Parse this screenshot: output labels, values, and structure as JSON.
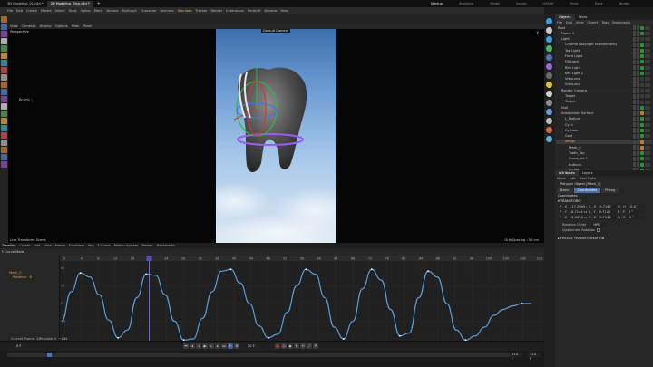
{
  "titlebar": {
    "tabs": [
      "3D Modeling_01.c4d *",
      "3D Modeling_Trick.c4d *"
    ],
    "plus": "+",
    "workspaces": [
      "Startup",
      "Standard",
      "Model",
      "Sculpt",
      "UVEdit",
      "Paint",
      "Track",
      "Nodes"
    ],
    "active_workspace": "Startup"
  },
  "menubar": {
    "items": [
      "File",
      "Edit",
      "Create",
      "Modes",
      "Select",
      "Tools",
      "Spline",
      "Mesh",
      "Volume",
      "MoGraph",
      "Character",
      "Animate",
      "Simulate",
      "Tracker",
      "Render",
      "Extensions",
      "Redshift",
      "Window",
      "Help"
    ]
  },
  "viewport": {
    "menu": [
      "View",
      "Cameras",
      "Display",
      "Options",
      "Filter",
      "Panel"
    ],
    "label": "Perspective",
    "camera_tag": "Default Camera",
    "transform_state": "Live Transform: Scene",
    "grid_spacing": "Grid Spacing : 50 cm",
    "gizmo_axis": "Y",
    "colors": {
      "bg": "#050505",
      "sky": "#4a7cb6"
    }
  },
  "objects_panel": {
    "tabs": [
      "Objects",
      "Takes"
    ],
    "menu": [
      "File",
      "Edit",
      "View",
      "Object",
      "Tags",
      "Bookmarks"
    ],
    "rows": [
      {
        "name": "Root",
        "indent": 0,
        "tag": "green"
      },
      {
        "name": "Dome 1",
        "indent": 1,
        "tag": "green"
      },
      {
        "name": "Light",
        "indent": 1,
        "tag": "none"
      },
      {
        "name": "Chrome (Daylight Environment)",
        "indent": 2,
        "tag": "green"
      },
      {
        "name": "Top Light",
        "indent": 2,
        "tag": "green"
      },
      {
        "name": "Front Light",
        "indent": 2,
        "tag": "green"
      },
      {
        "name": "Fill Light",
        "indent": 2,
        "tag": "green"
      },
      {
        "name": "Rim Light",
        "indent": 2,
        "tag": "green"
      },
      {
        "name": "Key Light 1",
        "indent": 2,
        "tag": "green"
      },
      {
        "name": "Vrbounce",
        "indent": 2,
        "tag": "none"
      },
      {
        "name": "Vrbounce",
        "indent": 2,
        "tag": "none"
      },
      {
        "name": "Render Camera",
        "indent": 1,
        "tag": "none"
      },
      {
        "name": "Target",
        "indent": 2,
        "tag": "none"
      },
      {
        "name": "Target",
        "indent": 2,
        "tag": "none"
      },
      {
        "name": "Null",
        "indent": 1,
        "tag": "green"
      },
      {
        "name": "Subdivision Surface",
        "indent": 1,
        "tag": "orange"
      },
      {
        "name": "L_Molture",
        "indent": 2,
        "tag": "green"
      },
      {
        "name": "Cyl.1",
        "indent": 2,
        "tag": "green"
      },
      {
        "name": "Cylinder",
        "indent": 2,
        "tag": "green"
      },
      {
        "name": "Gold",
        "indent": 2,
        "tag": "green"
      },
      {
        "name": "Wings",
        "indent": 2,
        "tag": "orange",
        "selected": true
      },
      {
        "name": "Mesh_0",
        "indent": 3,
        "tag": "orange"
      },
      {
        "name": "Tooth_Top",
        "indent": 3,
        "tag": "green"
      },
      {
        "name": "Crane_loc.1",
        "indent": 3,
        "tag": "green"
      },
      {
        "name": "Buttons",
        "indent": 3,
        "tag": "green"
      },
      {
        "name": "Sculpt",
        "indent": 3,
        "tag": "green"
      },
      {
        "name": "Tooth_Y",
        "indent": 3,
        "tag": "green"
      }
    ]
  },
  "attributes_panel": {
    "tabs": [
      "Attributes",
      "Layers"
    ],
    "menu": [
      "Mode",
      "Edit",
      "User Data"
    ],
    "object_label": "Polygon Object [Mesh_0]",
    "subtabs": [
      "Basic",
      "Coordinates",
      "Phong"
    ],
    "active_subtab": "Coordinates",
    "section": "Coordinates",
    "group": "TRANSFORM",
    "rows": [
      {
        "p": "P . X",
        "pv": "-17.2005 cm",
        "s": "S . X",
        "sv": "0.7142",
        "r": "R . H",
        "rv": "-0.0 °"
      },
      {
        "p": "P . Y",
        "pv": "-8.7144 cm",
        "s": "S . Y",
        "sv": "0.7142",
        "r": "R . P",
        "rv": "0 °"
      },
      {
        "p": "P . Z",
        "pv": "-2.0896 cm",
        "s": "S . Z",
        "sv": "0.7142",
        "r": "R . B",
        "rv": "0 °"
      }
    ],
    "rotation_order_label": "Rotation Order",
    "rotation_order_value": "HPB",
    "quaternion_label": "Quaternion Rotation",
    "freeze_label": "FREEZE TRANSFORMATION"
  },
  "timeline": {
    "tabs": [
      "Timeline"
    ],
    "menu": [
      "Create",
      "Edit",
      "View",
      "Frame",
      "Functions",
      "Key",
      "F-Curve",
      "Motion System",
      "Marker",
      "Bookmarks"
    ],
    "mode_label": "F-Curve Mode",
    "tracks": [
      {
        "name": "Mesh_0",
        "color": "#e0a040"
      },
      {
        "name": "Rotation . B",
        "color": "#e0a040"
      }
    ],
    "ruler": [
      "0",
      "4",
      "8",
      "12",
      "16",
      "20",
      "24",
      "28",
      "32",
      "36",
      "40",
      "44",
      "48",
      "52",
      "56",
      "60",
      "64",
      "68",
      "72",
      "76",
      "80",
      "84",
      "88",
      "92",
      "96",
      "100",
      "104",
      "108",
      "112"
    ],
    "y_labels": [
      "60",
      "30",
      "0",
      "-30",
      "-60"
    ],
    "current_frame_label": "Current Frame: 20",
    "preview_label": "Preview: 0 → 114",
    "playhead_frame": "20",
    "curve_color": "#5b9bd8",
    "curve_samples": [
      -30,
      20,
      52,
      45,
      15,
      -28,
      -58,
      -45,
      10,
      50,
      48,
      15,
      -30,
      -62,
      -60,
      -25,
      20,
      55,
      58,
      35,
      0,
      -38,
      -58,
      -52,
      -15,
      30,
      58,
      50,
      10,
      -40,
      -60,
      -30,
      25,
      58,
      40,
      -10,
      -55,
      -50,
      10,
      55,
      45,
      0,
      -45,
      -62,
      -55,
      -40,
      -20,
      -10,
      -4,
      0,
      0
    ]
  },
  "playback": {
    "start": "0 F",
    "end_field": "114 F",
    "end2_field": "114 F",
    "frame_field": "20 F",
    "buttons": [
      "first-frame",
      "prev-key",
      "prev-frame",
      "play",
      "next-frame",
      "next-key",
      "last-frame"
    ]
  },
  "left_tools": [
    "move",
    "scale",
    "rotate",
    "select",
    "live",
    "model",
    "points",
    "edges",
    "polys",
    "uv",
    "axis",
    "snap",
    "workplane",
    "lock",
    "sculpt",
    "paint",
    "knife",
    "brush",
    "magnet",
    "twist",
    "extrude"
  ],
  "right_tools": [
    "cube",
    "pen",
    "subdivide",
    "cloner",
    "deformer",
    "field",
    "camera",
    "light",
    "material",
    "render",
    "render-view",
    "render-settings",
    "tag",
    "python"
  ]
}
